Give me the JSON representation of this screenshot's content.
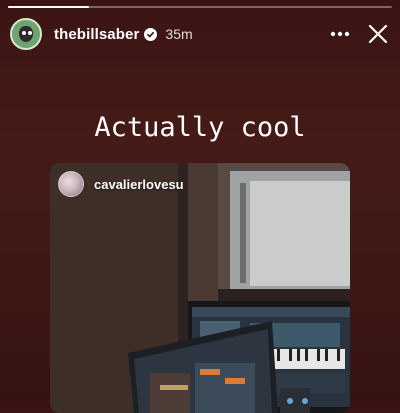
{
  "story": {
    "progress_fraction": 0.21,
    "user": {
      "username": "thebillsaber",
      "verified": true,
      "time_ago": "35m"
    },
    "icons": {
      "more": "more-horizontal-icon",
      "close": "close-icon",
      "verified": "verified-badge-icon"
    },
    "caption": "Actually cool"
  },
  "shared_post": {
    "username": "cavalierlovesu",
    "image_description_icon": "photo-music-studio"
  },
  "colors": {
    "background": "#3f1816",
    "text": "#ffffff",
    "avatar_green": "#6fa370"
  }
}
